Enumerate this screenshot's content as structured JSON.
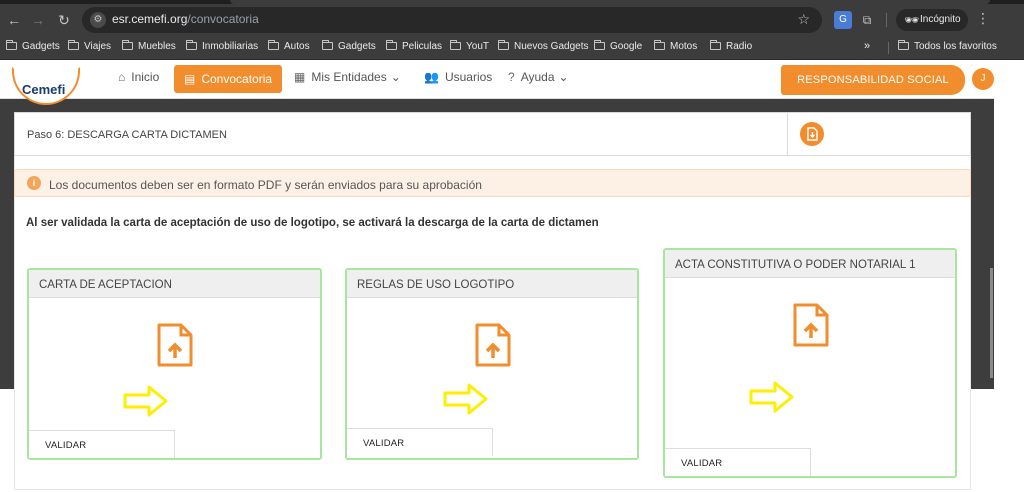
{
  "browser": {
    "url_domain": "esr.cemefi.org",
    "url_path": "/convocatoria",
    "incognito_label": "Incógnito",
    "bookmarks": [
      "Gadgets",
      "Viajes",
      "Muebles",
      "Inmobiliarias",
      "Autos",
      "Gadgets",
      "Peliculas",
      "YouT",
      "Nuevos Gadgets",
      "Google",
      "Motos",
      "Radio"
    ],
    "bookmarks_overflow": "»",
    "all_bookmarks_label": "Todos los favoritos"
  },
  "site": {
    "logo_text": "Cemefi",
    "nav": {
      "inicio": "Inicio",
      "convocatoria": "Convocatoria",
      "mis_entidades": "Mis Entidades",
      "usuarios": "Usuarios",
      "ayuda": "Ayuda"
    },
    "responsabilidad_label": "RESPONSABILIDAD SOCIAL",
    "user_initial": "J"
  },
  "step": {
    "label": "Paso 6: DESCARGA CARTA DICTAMEN"
  },
  "notice": {
    "text": "Los documentos deben ser en formato PDF y serán enviados para su aprobación"
  },
  "instruction": "Al ser validada la carta de aceptación de uso de logotipo, se activará la descarga de la carta de dictamen",
  "cards": [
    {
      "title": "CARTA DE ACEPTACION",
      "validate_label": "VALIDAR"
    },
    {
      "title": "REGLAS DE USO LOGOTIPO",
      "validate_label": "VALIDAR"
    },
    {
      "title": "ACTA CONSTITUTIVA O PODER NOTARIAL 1",
      "validate_label": "VALIDAR"
    }
  ],
  "colors": {
    "brand_orange": "#f18d2c",
    "card_border_green": "#a8e6a0",
    "annotation_yellow": "#ffee00"
  }
}
